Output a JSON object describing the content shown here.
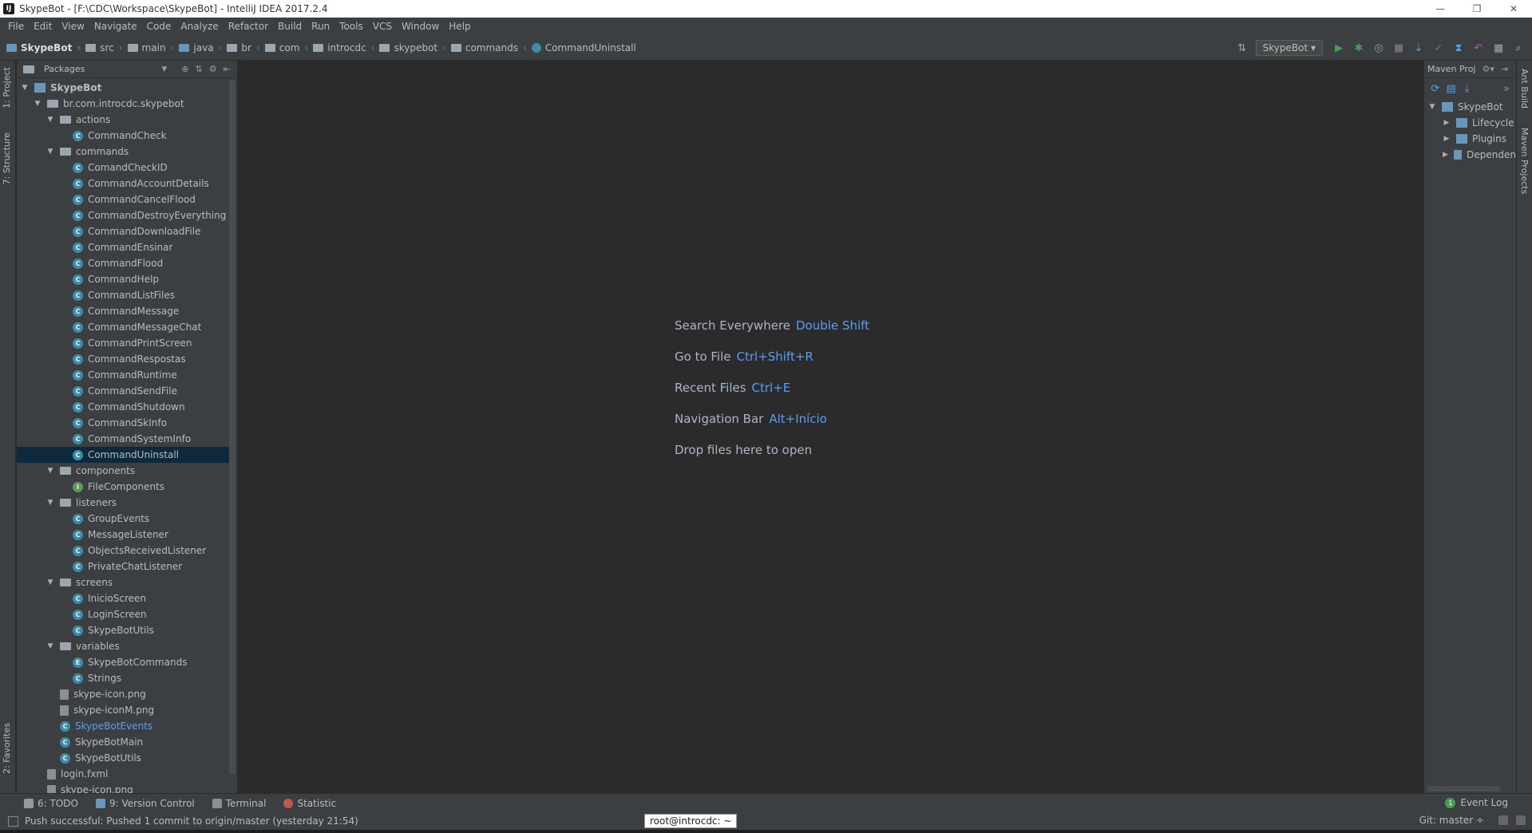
{
  "window": {
    "title": "SkypeBot - [F:\\CDC\\Workspace\\SkypeBot] - IntelliJ IDEA 2017.2.4",
    "logo_text": "IJ",
    "controls": [
      "—",
      "❐",
      "✕"
    ]
  },
  "menu": [
    "File",
    "Edit",
    "View",
    "Navigate",
    "Code",
    "Analyze",
    "Refactor",
    "Build",
    "Run",
    "Tools",
    "VCS",
    "Window",
    "Help"
  ],
  "breadcrumbs": [
    "SkypeBot",
    "src",
    "main",
    "java",
    "br",
    "com",
    "introcdc",
    "skypebot",
    "commands",
    "CommandUninstall"
  ],
  "toolbar": {
    "run_config": "SkypeBot",
    "icons": [
      "build-icon",
      "run-icon",
      "debug-icon",
      "coverage-icon",
      "stop-icon",
      "vcs-update-icon",
      "vcs-commit-icon",
      "vcs-history-icon",
      "vcs-revert-icon",
      "project-structure-icon",
      "search-everywhere-icon"
    ]
  },
  "left_stripe": {
    "project_tab": "1: Project",
    "structure_tab": "7: Structure",
    "favorites_tab": "2: Favorites"
  },
  "project_panel": {
    "title": "Packages",
    "tree": [
      {
        "label": "SkypeBot",
        "depth": 0,
        "icon": "project",
        "toggle": "▼",
        "bold": true
      },
      {
        "label": "br.com.introcdc.skypebot",
        "depth": 1,
        "icon": "folder",
        "toggle": "▼"
      },
      {
        "label": "actions",
        "depth": 2,
        "icon": "folder",
        "toggle": "▼"
      },
      {
        "label": "CommandCheck",
        "depth": 3,
        "icon": "class"
      },
      {
        "label": "commands",
        "depth": 2,
        "icon": "folder",
        "toggle": "▼"
      },
      {
        "label": "ComandCheckID",
        "depth": 3,
        "icon": "class"
      },
      {
        "label": "CommandAccountDetails",
        "depth": 3,
        "icon": "class"
      },
      {
        "label": "CommandCancelFlood",
        "depth": 3,
        "icon": "class"
      },
      {
        "label": "CommandDestroyEverything",
        "depth": 3,
        "icon": "class"
      },
      {
        "label": "CommandDownloadFile",
        "depth": 3,
        "icon": "class"
      },
      {
        "label": "CommandEnsinar",
        "depth": 3,
        "icon": "class"
      },
      {
        "label": "CommandFlood",
        "depth": 3,
        "icon": "class"
      },
      {
        "label": "CommandHelp",
        "depth": 3,
        "icon": "class"
      },
      {
        "label": "CommandListFiles",
        "depth": 3,
        "icon": "class"
      },
      {
        "label": "CommandMessage",
        "depth": 3,
        "icon": "class"
      },
      {
        "label": "CommandMessageChat",
        "depth": 3,
        "icon": "class"
      },
      {
        "label": "CommandPrintScreen",
        "depth": 3,
        "icon": "class"
      },
      {
        "label": "CommandRespostas",
        "depth": 3,
        "icon": "class"
      },
      {
        "label": "CommandRuntime",
        "depth": 3,
        "icon": "class"
      },
      {
        "label": "CommandSendFile",
        "depth": 3,
        "icon": "class"
      },
      {
        "label": "CommandShutdown",
        "depth": 3,
        "icon": "class"
      },
      {
        "label": "CommandSkInfo",
        "depth": 3,
        "icon": "class"
      },
      {
        "label": "CommandSystemInfo",
        "depth": 3,
        "icon": "class"
      },
      {
        "label": "CommandUninstall",
        "depth": 3,
        "icon": "class",
        "selected": true
      },
      {
        "label": "components",
        "depth": 2,
        "icon": "folder",
        "toggle": "▼"
      },
      {
        "label": "FileComponents",
        "depth": 3,
        "icon": "interface"
      },
      {
        "label": "listeners",
        "depth": 2,
        "icon": "folder",
        "toggle": "▼"
      },
      {
        "label": "GroupEvents",
        "depth": 3,
        "icon": "class"
      },
      {
        "label": "MessageListener",
        "depth": 3,
        "icon": "class"
      },
      {
        "label": "ObjectsReceivedListener",
        "depth": 3,
        "icon": "class"
      },
      {
        "label": "PrivateChatListener",
        "depth": 3,
        "icon": "class"
      },
      {
        "label": "screens",
        "depth": 2,
        "icon": "folder",
        "toggle": "▼"
      },
      {
        "label": "InicioScreen",
        "depth": 3,
        "icon": "class"
      },
      {
        "label": "LoginScreen",
        "depth": 3,
        "icon": "class"
      },
      {
        "label": "SkypeBotUtils",
        "depth": 3,
        "icon": "class"
      },
      {
        "label": "variables",
        "depth": 2,
        "icon": "folder",
        "toggle": "▼"
      },
      {
        "label": "SkypeBotCommands",
        "depth": 3,
        "icon": "enum"
      },
      {
        "label": "Strings",
        "depth": 3,
        "icon": "class"
      },
      {
        "label": "skype-icon.png",
        "depth": 2,
        "icon": "file"
      },
      {
        "label": "skype-iconM.png",
        "depth": 2,
        "icon": "file"
      },
      {
        "label": "SkypeBotEvents",
        "depth": 2,
        "icon": "class",
        "blue": true
      },
      {
        "label": "SkypeBotMain",
        "depth": 2,
        "icon": "class"
      },
      {
        "label": "SkypeBotUtils",
        "depth": 2,
        "icon": "class"
      },
      {
        "label": "login.fxml",
        "depth": 1,
        "icon": "file"
      },
      {
        "label": "skype-icon.png",
        "depth": 1,
        "icon": "file"
      }
    ]
  },
  "editor_hints": [
    {
      "label": "Search Everywhere",
      "key": "Double Shift"
    },
    {
      "label": "Go to File",
      "key": "Ctrl+Shift+R"
    },
    {
      "label": "Recent Files",
      "key": "Ctrl+E"
    },
    {
      "label": "Navigation Bar",
      "key": "Alt+Início"
    },
    {
      "label": "Drop files here to open",
      "key": ""
    }
  ],
  "maven_panel": {
    "title": "Maven Proj",
    "tree": [
      {
        "label": "SkypeBot",
        "toggle": "▼",
        "depth": 0
      },
      {
        "label": "Lifecycle",
        "toggle": "▶",
        "depth": 1
      },
      {
        "label": "Plugins",
        "toggle": "▶",
        "depth": 1
      },
      {
        "label": "Dependen",
        "toggle": "▶",
        "depth": 1
      }
    ]
  },
  "right_stripe": {
    "ant_tab": "Ant Build",
    "maven_tab": "Maven Projects"
  },
  "bottom_tools": [
    {
      "label": "6: TODO",
      "icon": "todo-icon",
      "color": "#8f9ba3"
    },
    {
      "label": "9: Version Control",
      "icon": "version-control-icon",
      "color": "#6897bb"
    },
    {
      "label": "Terminal",
      "icon": "terminal-icon",
      "color": "#8a8f93"
    },
    {
      "label": "Statistic",
      "icon": "statistic-icon",
      "color": "#c75450"
    }
  ],
  "event_log": "Event Log",
  "status": {
    "message": "Push successful: Pushed 1 commit to origin/master (yesterday 21:54)",
    "terminal_tooltip": "root@introcdc: ~",
    "git_branch": "Git: master ÷"
  },
  "colors": {
    "background": "#2b2b2b",
    "panel": "#3c3f41",
    "selection": "#0d293e",
    "accent": "#589df6"
  }
}
